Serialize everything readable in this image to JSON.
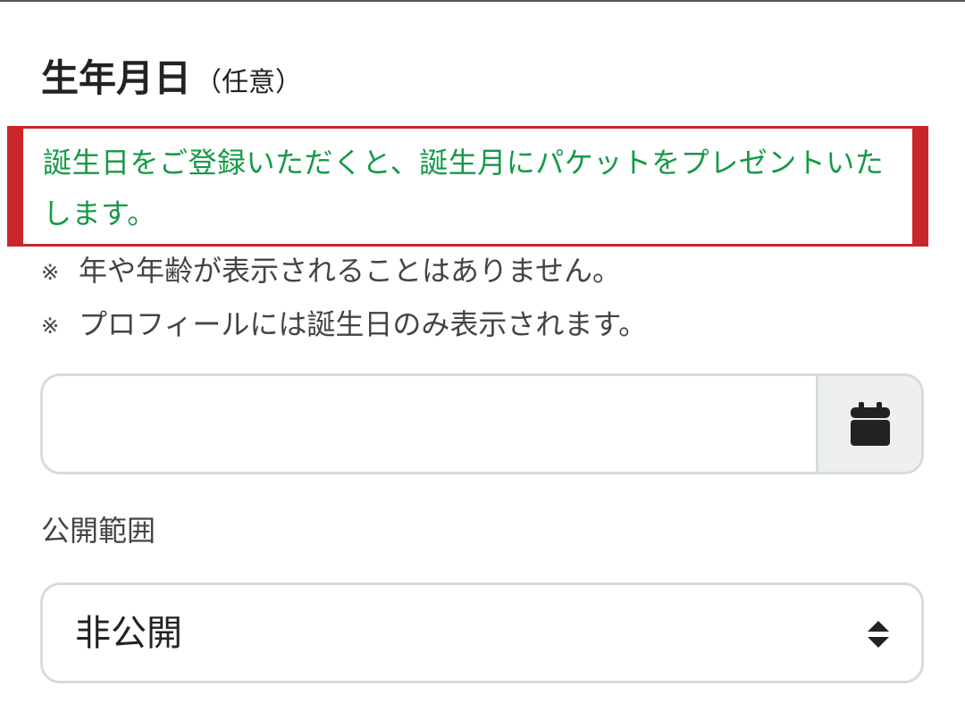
{
  "section": {
    "title": "生年月日",
    "optional": "（任意）"
  },
  "notice": {
    "text": "誕生日をご登録いただくと、誕生月にパケットをプレゼントいたします。",
    "color": "#149a45",
    "border_color": "#c9262c"
  },
  "notes": [
    {
      "mark": "※",
      "text": "年や年齢が表示されることはありません。"
    },
    {
      "mark": "※",
      "text": "プロフィールには誕生日のみ表示されます。"
    }
  ],
  "birthday_input": {
    "value": "",
    "placeholder": "",
    "button_icon": "calendar-icon"
  },
  "visibility": {
    "label": "公開範囲",
    "selected": "非公開",
    "icon": "sort-arrows-icon"
  }
}
